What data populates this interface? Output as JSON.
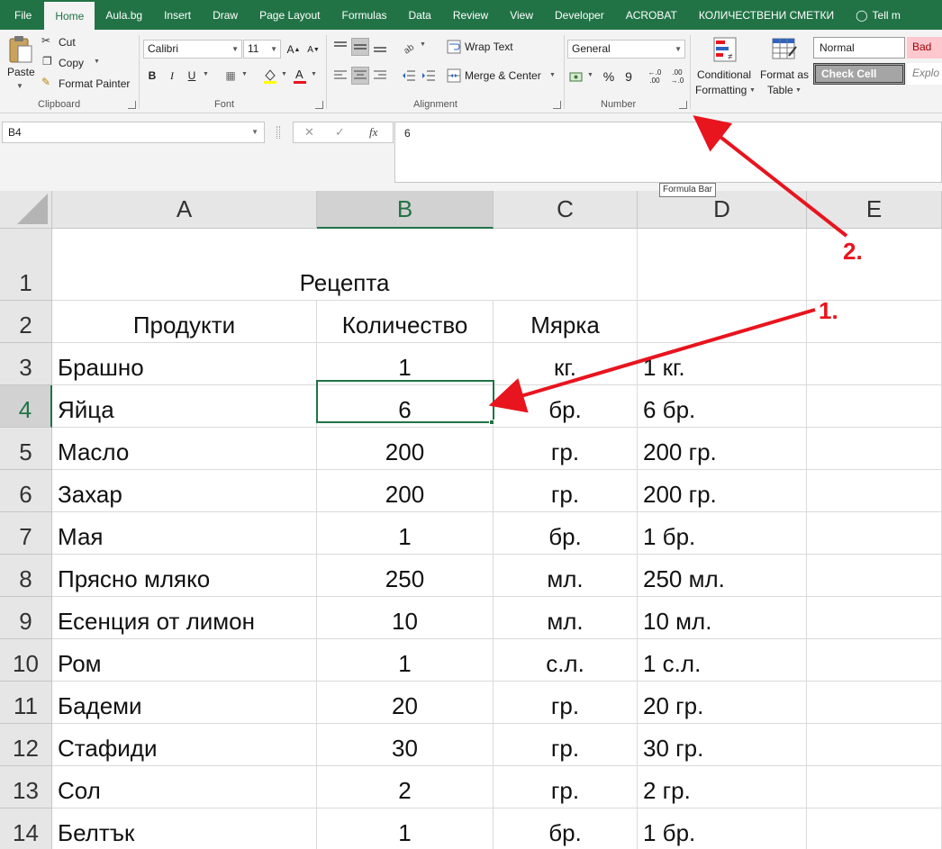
{
  "tabs": [
    "File",
    "Home",
    "Aula.bg",
    "Insert",
    "Draw",
    "Page Layout",
    "Formulas",
    "Data",
    "Review",
    "View",
    "Developer",
    "ACROBAT",
    "КОЛИЧЕСТВЕНИ СМЕТКИ",
    "Tell m"
  ],
  "active_tab": "Home",
  "ribbon": {
    "clipboard": {
      "label": "Clipboard",
      "paste": "Paste",
      "cut": "Cut",
      "copy": "Copy",
      "format_painter": "Format Painter"
    },
    "font": {
      "label": "Font",
      "name": "Calibri",
      "size": "11",
      "bold": "B",
      "italic": "I",
      "underline": "U"
    },
    "alignment": {
      "label": "Alignment",
      "wrap_text": "Wrap Text",
      "merge_center": "Merge & Center"
    },
    "number": {
      "label": "Number",
      "format": "General",
      "percent": "%",
      "comma": "9",
      "inc_decimal": "←.0 .00",
      "dec_decimal": ".00 →.0"
    },
    "styles": {
      "conditional_formatting": [
        "Conditional",
        "Formatting"
      ],
      "format_as_table": [
        "Format as",
        "Table"
      ],
      "normal": "Normal",
      "bad": "Bad",
      "check_cell": "Check Cell",
      "explanatory": "Explo"
    }
  },
  "formula_bar": {
    "name_box": "B4",
    "value": "6",
    "tooltip": "Formula Bar",
    "cancel": "✕",
    "enter": "✓",
    "fx": "fx"
  },
  "columns": [
    "A",
    "B",
    "C",
    "D",
    "E"
  ],
  "selected_cell": {
    "column": "B",
    "row": "4"
  },
  "rows": [
    {
      "num": "1",
      "a": "Рецепта",
      "b": "",
      "c": "",
      "d": ""
    },
    {
      "num": "2",
      "a": "Продукти",
      "b": "Количество",
      "c": "Мярка",
      "d": ""
    },
    {
      "num": "3",
      "a": "Брашно",
      "b": "1",
      "c": "кг.",
      "d": "1 кг."
    },
    {
      "num": "4",
      "a": "Яйца",
      "b": "6",
      "c": "бр.",
      "d": "6 бр."
    },
    {
      "num": "5",
      "a": "Масло",
      "b": "200",
      "c": "гр.",
      "d": "200 гр."
    },
    {
      "num": "6",
      "a": "Захар",
      "b": "200",
      "c": "гр.",
      "d": "200 гр."
    },
    {
      "num": "7",
      "a": "Мая",
      "b": "1",
      "c": "бр.",
      "d": "1 бр."
    },
    {
      "num": "8",
      "a": "Прясно мляко",
      "b": "250",
      "c": "мл.",
      "d": "250 мл."
    },
    {
      "num": "9",
      "a": "Есенция от лимон",
      "b": "10",
      "c": "мл.",
      "d": "10 мл."
    },
    {
      "num": "10",
      "a": "Ром",
      "b": "1",
      "c": "с.л.",
      "d": "1 с.л."
    },
    {
      "num": "11",
      "a": "Бадеми",
      "b": "20",
      "c": "гр.",
      "d": "20 гр."
    },
    {
      "num": "12",
      "a": "Стафиди",
      "b": "30",
      "c": "гр.",
      "d": "30 гр."
    },
    {
      "num": "13",
      "a": "Сол",
      "b": "2",
      "c": "гр.",
      "d": "2 гр."
    },
    {
      "num": "14",
      "a": "Белтък",
      "b": "1",
      "c": "бр.",
      "d": "1 бр."
    }
  ],
  "annotations": {
    "one": "1.",
    "two": "2."
  },
  "colors": {
    "excel_green": "#217346",
    "annotation_red": "#e8141e"
  }
}
